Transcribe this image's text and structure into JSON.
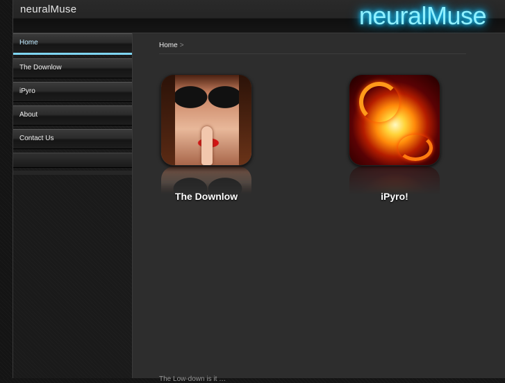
{
  "header": {
    "site_title": "neuralMuse",
    "logo_text": "neuralMuse",
    "logo_color": "#8ff0ff"
  },
  "sidebar": {
    "items": [
      {
        "label": "Home",
        "active": true
      },
      {
        "label": "The Downlow",
        "active": false
      },
      {
        "label": "iPyro",
        "active": false
      },
      {
        "label": "About",
        "active": false
      },
      {
        "label": "Contact Us",
        "active": false
      }
    ],
    "active_color": "#7fd6f5"
  },
  "breadcrumb": {
    "current": "Home",
    "separator": ">"
  },
  "apps": [
    {
      "caption": "The Downlow",
      "icon": "woman-lips-sunglasses-icon"
    },
    {
      "caption": "iPyro!",
      "icon": "fire-swirl-icon"
    }
  ],
  "footer": {
    "text": "The Low-down is it …"
  }
}
